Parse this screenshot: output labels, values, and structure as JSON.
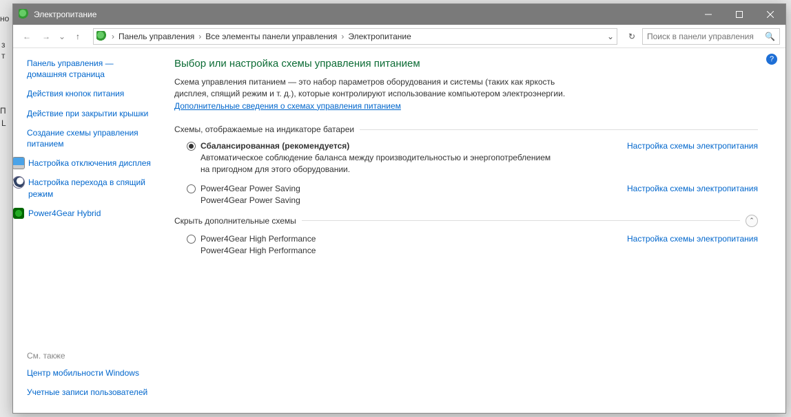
{
  "titlebar": {
    "title": "Электропитание"
  },
  "breadcrumb": {
    "seg1": "Панель управления",
    "seg2": "Все элементы панели управления",
    "seg3": "Электропитание"
  },
  "search": {
    "placeholder": "Поиск в панели управления"
  },
  "sidebar": {
    "home": "Панель управления — домашняя страница",
    "links": [
      "Действия кнопок питания",
      "Действие при закрытии крышки",
      "Создание схемы управления питанием",
      "Настройка отключения дисплея",
      "Настройка перехода в спящий режим",
      "Power4Gear Hybrid"
    ],
    "see_also_label": "См. также",
    "see_also": [
      "Центр мобильности Windows",
      "Учетные записи пользователей"
    ]
  },
  "main": {
    "heading": "Выбор или настройка схемы управления питанием",
    "desc": "Схема управления питанием — это набор параметров оборудования и системы (таких как яркость дисплея, спящий режим и т. д.), которые контролируют использование компьютером электроэнергии. ",
    "more_link": "Дополнительные сведения о схемах управления питанием",
    "group1_label": "Схемы, отображаемые на индикаторе батареи",
    "group2_label": "Скрыть дополнительные схемы",
    "config_link": "Настройка схемы электропитания",
    "plans": [
      {
        "name": "Сбалансированная (рекомендуется)",
        "desc": "Автоматическое соблюдение баланса между производительностью и энергопотреблением на пригодном для этого оборудовании.",
        "checked": true,
        "bold": true
      },
      {
        "name": "Power4Gear Power Saving",
        "desc": "Power4Gear Power Saving",
        "checked": false,
        "bold": false
      },
      {
        "name": "Power4Gear High Performance",
        "desc": "Power4Gear High Performance",
        "checked": false,
        "bold": false
      }
    ]
  },
  "edge": {
    "t1": "но",
    "t2": "з",
    "t3": "т",
    "t4": "П",
    "t5": "L"
  }
}
